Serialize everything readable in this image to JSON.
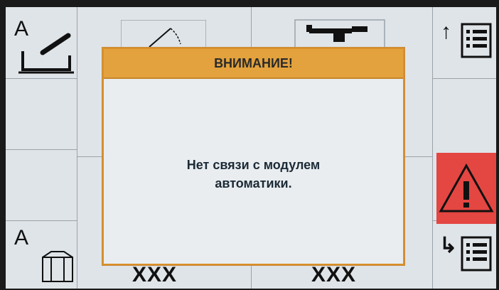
{
  "dialog": {
    "title": "ВНИМАНИЕ!",
    "message_line1": "Нет связи с модулем",
    "message_line2": "автоматики."
  },
  "softkeys": {
    "top_left_letter": "A",
    "bottom_left_letter": "A",
    "top_right_arrow": "↑",
    "bottom_right_arrow": "↳"
  },
  "bottom_labels": {
    "left": "XXX",
    "right": "XXX"
  },
  "colors": {
    "dialog_header": "#e3a23d",
    "warning_background": "#e44642"
  }
}
